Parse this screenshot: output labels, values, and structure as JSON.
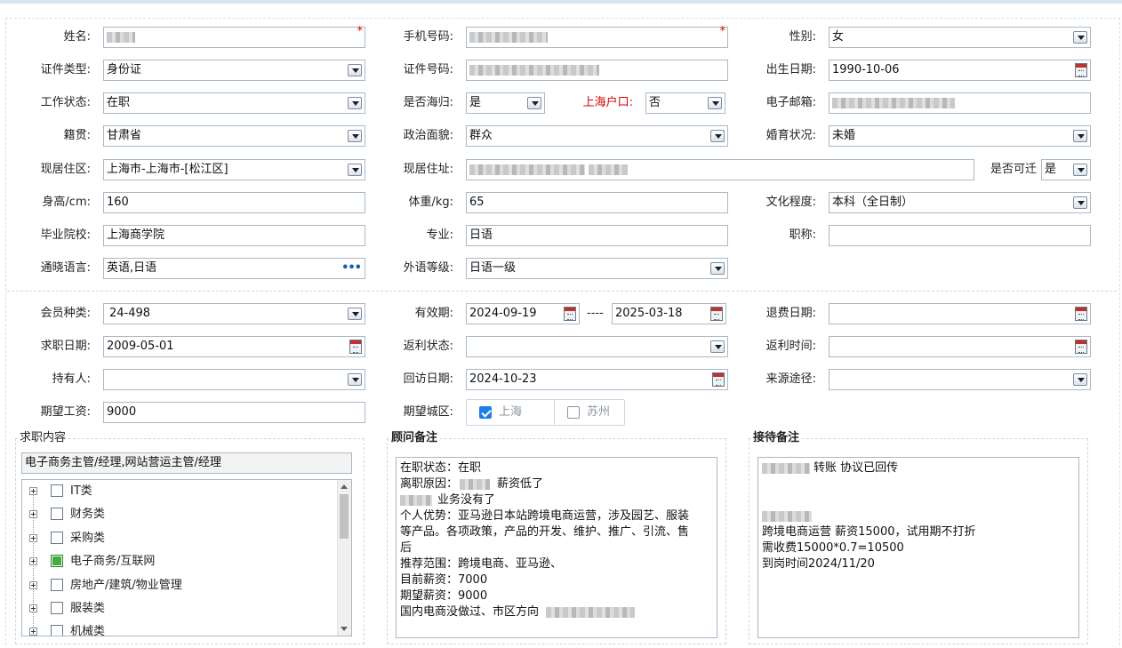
{
  "form": {
    "name": {
      "label": "姓名:",
      "required_mark": "*"
    },
    "phone": {
      "label": "手机号码:",
      "required_mark": "*"
    },
    "gender": {
      "label": "性别:",
      "value": "女"
    },
    "id_type": {
      "label": "证件类型:",
      "value": "身份证"
    },
    "id_no": {
      "label": "证件号码:"
    },
    "birth_date": {
      "label": "出生日期:",
      "value": "1990-10-06"
    },
    "work_status": {
      "label": "工作状态:",
      "value": "在职"
    },
    "returnee": {
      "label": "是否海归:",
      "value": "是"
    },
    "shanghai_hukou": {
      "label": "上海户口:",
      "value": "否"
    },
    "email": {
      "label": "电子邮箱:"
    },
    "native_place": {
      "label": "籍贯:",
      "value": "甘肃省"
    },
    "political": {
      "label": "政治面貌:",
      "value": "群众"
    },
    "marital": {
      "label": "婚育状况:",
      "value": "未婚"
    },
    "residence_area": {
      "label": "现居住区:",
      "value": "上海市-上海市-[松江区]"
    },
    "residence_addr": {
      "label": "现居住址:"
    },
    "relocate": {
      "label": "是否可迁",
      "value": "是"
    },
    "height": {
      "label": "身高/cm:",
      "value": "160"
    },
    "weight": {
      "label": "体重/kg:",
      "value": "65"
    },
    "education": {
      "label": "文化程度:",
      "value": "本科（全日制）"
    },
    "school": {
      "label": "毕业院校:",
      "value": "上海商学院"
    },
    "major": {
      "label": "专业:",
      "value": "日语"
    },
    "title": {
      "label": "职称:",
      "value": ""
    },
    "languages": {
      "label": "通晓语言:",
      "value": "英语,日语",
      "more": "•••"
    },
    "lang_level": {
      "label": "外语等级:",
      "value": "日语一级"
    },
    "member_type": {
      "label": "会员种类:",
      "value": "24-498"
    },
    "valid_period": {
      "label": "有效期:",
      "start": "2024-09-19",
      "sep": "----",
      "end": "2025-03-18"
    },
    "refund_date": {
      "label": "退费日期:",
      "value": ""
    },
    "job_date": {
      "label": "求职日期:",
      "value": "2009-05-01"
    },
    "rebate_status": {
      "label": "返利状态:",
      "value": ""
    },
    "rebate_time": {
      "label": "返利时间:",
      "value": ""
    },
    "holder": {
      "label": "持有人:",
      "value": ""
    },
    "revisit_date": {
      "label": "回访日期:",
      "value": "2024-10-23"
    },
    "source": {
      "label": "来源途径:",
      "value": ""
    },
    "expected_salary": {
      "label": "期望工资:",
      "value": "9000"
    },
    "expected_city": {
      "label": "期望城区:",
      "options": [
        {
          "label": "上海",
          "checked": true
        },
        {
          "label": "苏州",
          "checked": false
        }
      ]
    }
  },
  "job_content": {
    "title": "求职内容",
    "selected": "电子商务主管/经理,网站营运主管/经理",
    "categories": [
      {
        "label": "IT类",
        "checked": false
      },
      {
        "label": "财务类",
        "checked": false
      },
      {
        "label": "采购类",
        "checked": false
      },
      {
        "label": "电子商务/互联网",
        "checked": true
      },
      {
        "label": "房地产/建筑/物业管理",
        "checked": false
      },
      {
        "label": "服装类",
        "checked": false
      },
      {
        "label": "机械类",
        "checked": false
      }
    ]
  },
  "consultant_notes": {
    "title": "顾问备注",
    "lines": [
      "在职状态：在职",
      "离职原因：",
      "业务没有了",
      "个人优势：亚马逊日本站跨境电商运营，涉及园艺、服装",
      "等产品。各项政策，产品的开发、维护、推广、引流、售",
      "后",
      "推荐范围：跨境电商、亚马逊、",
      "目前薪资：7000",
      "期望薪资：9000",
      "国内电商没做过、市区方向"
    ],
    "inline_tail_1": "薪资低了"
  },
  "reception_notes": {
    "title": "接待备注",
    "line1_tail": "转账  协议已回传",
    "lines": [
      "跨境电商运营  薪资15000，试用期不打折",
      "需收费15000*0.7=10500",
      "到岗时间2024/11/20"
    ]
  }
}
